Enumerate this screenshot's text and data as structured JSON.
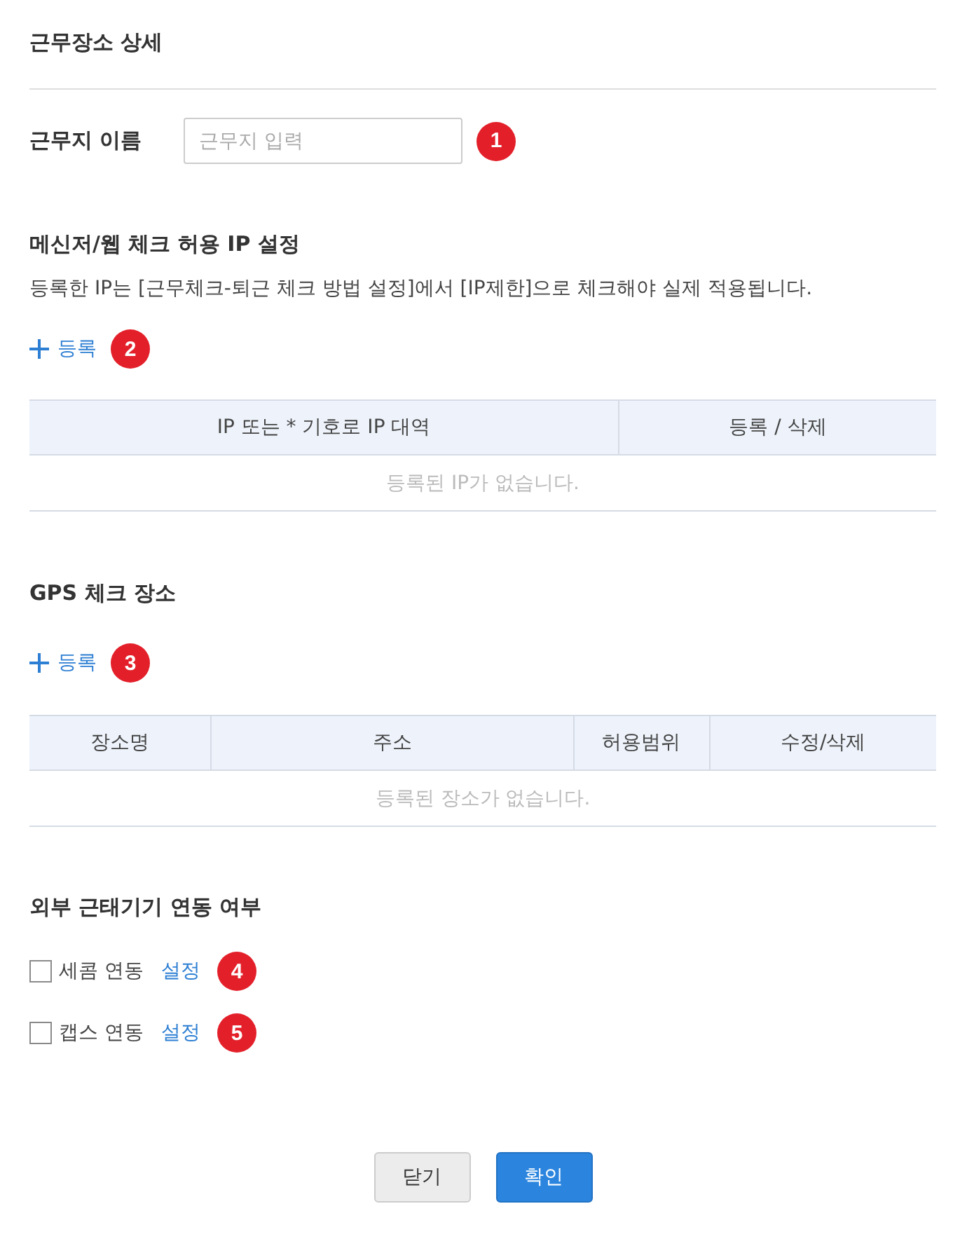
{
  "title": "근무장소 상세",
  "name_field": {
    "label": "근무지 이름",
    "placeholder": "근무지 입력",
    "marker": "1"
  },
  "ip_section": {
    "title": "메신저/웹 체크 허용 IP 설정",
    "description": "등록한 IP는 [근무체크-퇴근 체크 방법 설정]에서 [IP제한]으로 체크해야 실제 적용됩니다.",
    "add_button": {
      "label": "등록",
      "marker": "2"
    },
    "table": {
      "columns": [
        "IP 또는 * 기호로 IP 대역",
        "등록 / 삭제"
      ],
      "empty_message": "등록된 IP가 없습니다."
    }
  },
  "gps_section": {
    "title": "GPS 체크 장소",
    "add_button": {
      "label": "등록",
      "marker": "3"
    },
    "table": {
      "columns": [
        "장소명",
        "주소",
        "허용범위",
        "수정/삭제"
      ],
      "empty_message": "등록된 장소가 없습니다."
    }
  },
  "devices_section": {
    "title": "외부 근태기기 연동 여부",
    "items": [
      {
        "label": "세콤 연동",
        "checked": false,
        "link": "설정",
        "marker": "4"
      },
      {
        "label": "캡스 연동",
        "checked": false,
        "link": "설정",
        "marker": "5"
      }
    ]
  },
  "buttons": [
    {
      "label": "닫기",
      "kind": "secondary"
    },
    {
      "label": "확인",
      "kind": "primary"
    }
  ]
}
